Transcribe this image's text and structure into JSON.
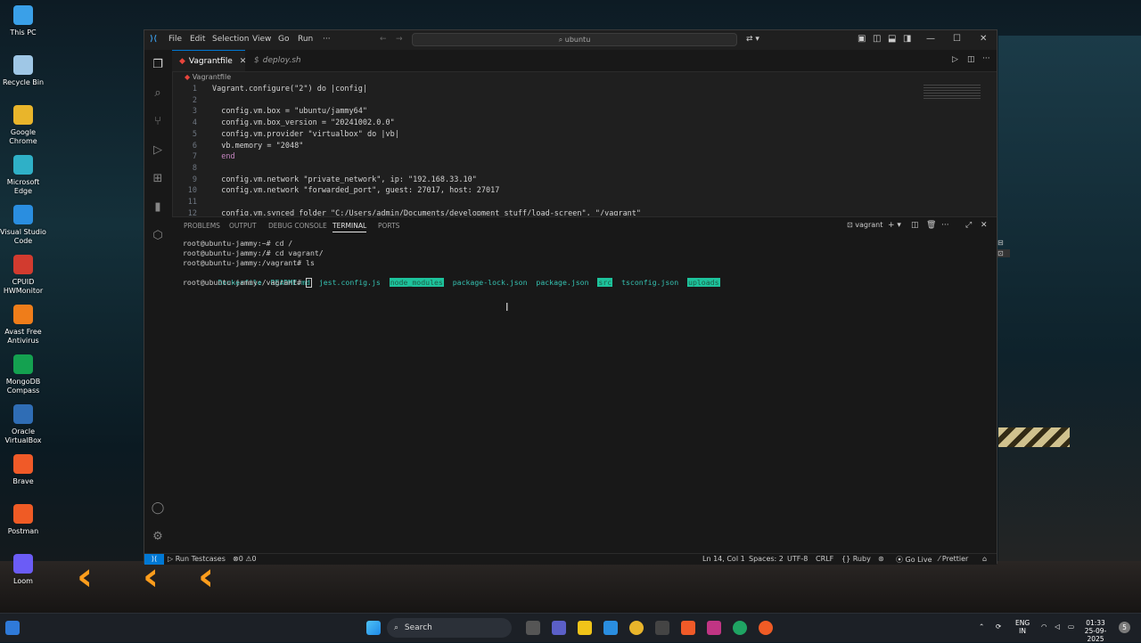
{
  "desktop": {
    "icons": [
      {
        "label": "This PC",
        "color": "#3aa0e8"
      },
      {
        "label": "Recycle Bin",
        "color": "#9fc7e6"
      },
      {
        "label": "Google Chrome",
        "color": "#e9b52b"
      },
      {
        "label": "Microsoft Edge",
        "color": "#2fb0c7"
      },
      {
        "label": "Visual Studio Code",
        "color": "#2a8ee0"
      },
      {
        "label": "CPUID HWMonitor",
        "color": "#d23b2f"
      },
      {
        "label": "Avast Free Antivirus",
        "color": "#ef7d1a"
      },
      {
        "label": "MongoDB Compass",
        "color": "#14a150"
      },
      {
        "label": "Oracle VirtualBox",
        "color": "#2f6db5"
      },
      {
        "label": "Brave",
        "color": "#f05a28"
      },
      {
        "label": "Postman",
        "color": "#ef5b25"
      },
      {
        "label": "Loom",
        "color": "#6b5cf6"
      }
    ]
  },
  "window": {
    "menu": [
      "File",
      "Edit",
      "Selection",
      "View",
      "Go",
      "Run",
      "···"
    ],
    "search_text": "ubuntu",
    "tabs": [
      {
        "label": "Vagrantfile",
        "active": true
      },
      {
        "label": "deploy.sh",
        "active": false
      }
    ],
    "breadcrumb": "Vagrantfile",
    "code_lines": [
      {
        "n": "1",
        "text": "Vagrant.configure(\"2\") do |config|"
      },
      {
        "n": "2",
        "text": ""
      },
      {
        "n": "3",
        "text": "  config.vm.box = \"ubuntu/jammy64\""
      },
      {
        "n": "4",
        "text": "  config.vm.box_version = \"20241002.0.0\""
      },
      {
        "n": "5",
        "text": "  config.vm.provider \"virtualbox\" do |vb|"
      },
      {
        "n": "6",
        "text": "  vb.memory = \"2048\""
      },
      {
        "n": "7",
        "text": "  end"
      },
      {
        "n": "8",
        "text": ""
      },
      {
        "n": "9",
        "text": "  config.vm.network \"private_network\", ip: \"192.168.33.10\""
      },
      {
        "n": "10",
        "text": "  config.vm.network \"forwarded_port\", guest: 27017, host: 27017"
      },
      {
        "n": "11",
        "text": ""
      },
      {
        "n": "12",
        "text": "  config.vm.synced_folder \"C:/Users/admin/Documents/development stuff/load-screen\", \"/vagrant\""
      }
    ],
    "panel": {
      "tabs": [
        "PROBLEMS",
        "OUTPUT",
        "DEBUG CONSOLE",
        "TERMINAL",
        "PORTS"
      ],
      "active_tab": "TERMINAL",
      "terminal_name": "vagrant",
      "lines": [
        "root@ubuntu-jammy:~# cd /",
        "root@ubuntu-jammy:/# cd vagrant/",
        "root@ubuntu-jammy:/vagrant# ls"
      ],
      "ls_items": [
        "Dockerfile",
        "README.md",
        "jest.config.js",
        "node_modules",
        "package-lock.json",
        "package.json",
        "src",
        "tsconfig.json",
        "uploads"
      ],
      "prompt": "root@ubuntu-jammy:/vagrant# "
    },
    "status": {
      "run_testcases": "Run Testcases",
      "errors": "0",
      "warnings": "0",
      "position": "Ln 14, Col 1",
      "spaces": "Spaces: 2",
      "encoding": "UTF-8",
      "eol": "CRLF",
      "language": "Ruby",
      "go_live": "Go Live",
      "prettier": "Prettier"
    }
  },
  "taskbar": {
    "search_label": "Search",
    "lang_top": "ENG",
    "lang_bottom": "IN",
    "time": "01:33",
    "date": "25-09-2025",
    "notif_count": "5"
  }
}
